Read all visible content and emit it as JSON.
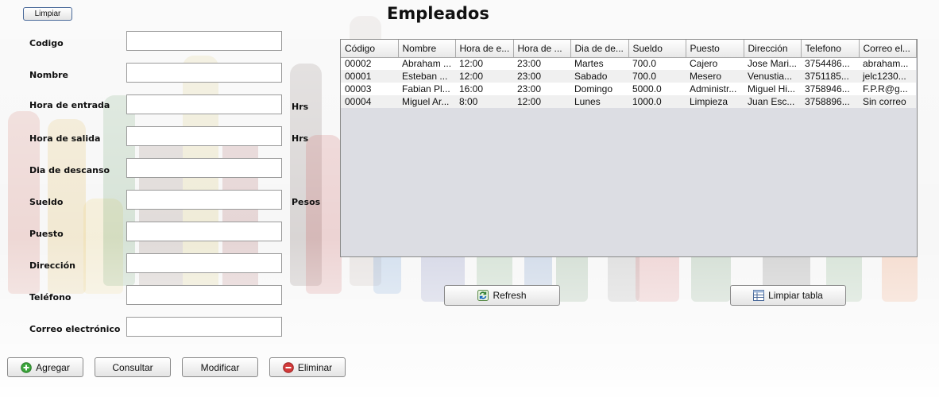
{
  "window": {
    "title": "Empleados"
  },
  "top": {
    "clear_label": "Limpiar"
  },
  "form": {
    "fields": [
      {
        "label": "Codigo",
        "value": ""
      },
      {
        "label": "Nombre",
        "value": ""
      },
      {
        "label": "Hora de entrada",
        "value": "",
        "unit": "Hrs"
      },
      {
        "label": "Hora de salida",
        "value": "",
        "unit": "Hrs"
      },
      {
        "label": "Dia de descanso",
        "value": ""
      },
      {
        "label": "Sueldo",
        "value": "",
        "unit": "Pesos"
      },
      {
        "label": "Puesto",
        "value": ""
      },
      {
        "label": "Dirección",
        "value": ""
      },
      {
        "label": "Teléfono",
        "value": ""
      },
      {
        "label": "Correo electrónico",
        "value": ""
      }
    ]
  },
  "table": {
    "columns": [
      "Código",
      "Nombre",
      "Hora de e...",
      "Hora de ...",
      "Dia de de...",
      "Sueldo",
      "Puesto",
      "Dirección",
      "Telefono",
      "Correo el..."
    ],
    "rows": [
      [
        "00002",
        "Abraham ...",
        "12:00",
        "23:00",
        "Martes",
        "700.0",
        "Cajero",
        "Jose Mari...",
        "3754486...",
        "abraham..."
      ],
      [
        "00001",
        "Esteban ...",
        "12:00",
        "23:00",
        "Sabado",
        "700.0",
        "Mesero",
        "Venustia...",
        "3751185...",
        "jelc1230..."
      ],
      [
        "00003",
        "Fabian Pl...",
        "16:00",
        "23:00",
        "Domingo",
        "5000.0",
        "Administr...",
        "Miguel Hi...",
        "3758946...",
        "F.P.R@g..."
      ],
      [
        "00004",
        "Miguel Ar...",
        "8:00",
        "12:00",
        "Lunes",
        "1000.0",
        "Limpieza",
        "Juan Esc...",
        "3758896...",
        "Sin correo"
      ]
    ]
  },
  "actions": {
    "refresh": "Refresh",
    "clear_table": "Limpiar tabla",
    "add": "Agregar",
    "query": "Consultar",
    "modify": "Modificar",
    "delete": "Eliminar"
  },
  "icons": {
    "refresh": "refresh-icon",
    "clear_table": "table-icon",
    "add": "plus-circle-icon",
    "delete": "minus-circle-icon"
  },
  "colors": {
    "add_icon": "#3ba63b",
    "delete_icon": "#d23a3a",
    "table_background": "#dcdde3"
  }
}
